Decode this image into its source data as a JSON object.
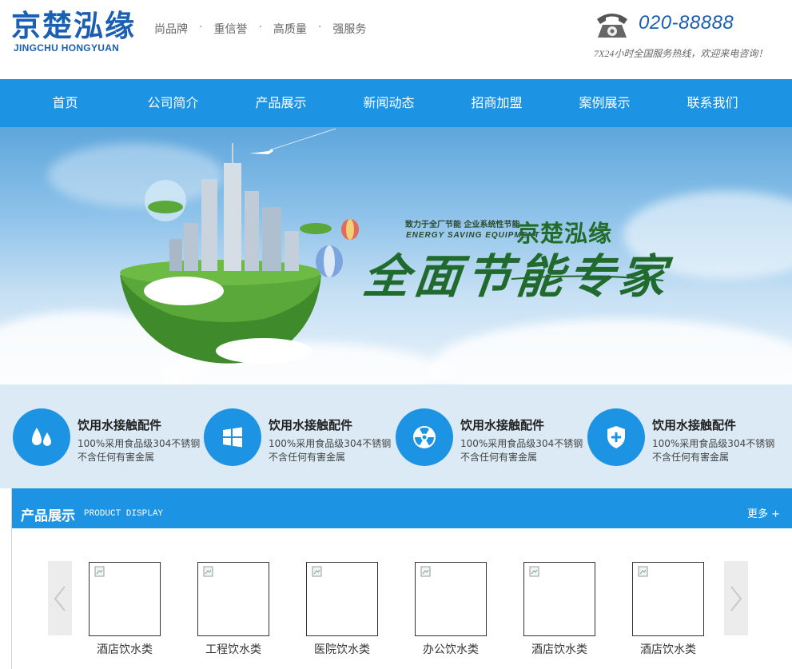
{
  "header": {
    "logo_cn": "京楚泓缘",
    "logo_en": "JINGCHU HONGYUAN",
    "slogans": [
      "尚品牌",
      "重信誉",
      "高质量",
      "强服务"
    ],
    "separator": "·",
    "phone": "020-88888",
    "hotline": "7X24小时全国服务热线，欢迎来电咨询！"
  },
  "nav": {
    "items": [
      "首页",
      "公司简介",
      "产品展示",
      "新闻动态",
      "招商加盟",
      "案例展示",
      "联系我们"
    ]
  },
  "banner": {
    "tagline_cn": "致力于全厂节能 企业系统性节能",
    "tagline_en": "ENERGY  SAVING  EQUIPMENT",
    "brand": "京楚泓缘",
    "headline": "全面节能专家"
  },
  "features": [
    {
      "icon": "water-drops-icon",
      "title": "饮用水接触配件",
      "line1": "100%采用食品级304不锈钢",
      "line2": "不含任何有害金属"
    },
    {
      "icon": "windows-icon",
      "title": "饮用水接触配件",
      "line1": "100%采用食品级304不锈钢",
      "line2": "不含任何有害金属"
    },
    {
      "icon": "radiation-icon",
      "title": "饮用水接触配件",
      "line1": "100%采用食品级304不锈钢",
      "line2": "不含任何有害金属"
    },
    {
      "icon": "shield-plus-icon",
      "title": "饮用水接触配件",
      "line1": "100%采用食品级304不锈钢",
      "line2": "不含任何有害金属"
    }
  ],
  "products": {
    "title": "产品展示",
    "subtitle": "PRODUCT DISPLAY",
    "more": "更多 +",
    "items": [
      "酒店饮水类",
      "工程饮水类",
      "医院饮水类",
      "办公饮水类",
      "酒店饮水类",
      "酒店饮水类"
    ]
  },
  "colors": {
    "primary": "#1d93e3",
    "brand_blue": "#1a5fb4",
    "feature_bg": "#dbeaf5",
    "banner_green": "#1f6a2c"
  }
}
